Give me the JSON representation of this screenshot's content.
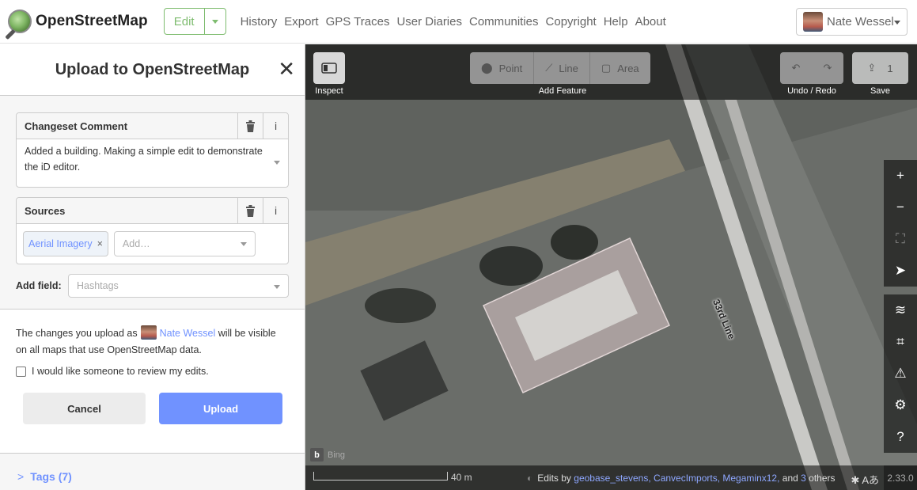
{
  "header": {
    "logo_text": "OpenStreetMap",
    "edit_label": "Edit",
    "nav": [
      "History",
      "Export",
      "GPS Traces",
      "User Diaries",
      "Communities",
      "Copyright",
      "Help",
      "About"
    ],
    "user_name": "Nate Wessel"
  },
  "sidebar": {
    "title": "Upload to OpenStreetMap",
    "changeset": {
      "label": "Changeset Comment",
      "value": "Added a building. Making a simple edit to demonstrate the iD editor."
    },
    "sources": {
      "label": "Sources",
      "chip": "Aerial Imagery",
      "placeholder": "Add…"
    },
    "add_field": {
      "label": "Add field:",
      "placeholder": "Hashtags"
    },
    "notice": {
      "before": "The changes you upload as",
      "user": "Nate Wessel",
      "after": "will be visible on all maps that use OpenStreetMap data."
    },
    "review_label": "I would like someone to review my edits.",
    "cancel_label": "Cancel",
    "upload_label": "Upload",
    "tags_label": "Tags (7)"
  },
  "map": {
    "inspect_label": "Inspect",
    "add_feature_label": "Add Feature",
    "modes": [
      "Point",
      "Line",
      "Area"
    ],
    "undo_redo_label": "Undo / Redo",
    "save_label": "Save",
    "save_count": "1",
    "road_label": "33rd Line",
    "imagery": "Bing",
    "scale_text": "40 m",
    "attribution": {
      "prefix": "Edits by",
      "users": "geobase_stevens, CanvecImports, Megaminx12,",
      "suffix_and": "and",
      "others_count": "3",
      "others_label": "others"
    },
    "version": "2.33.0"
  }
}
